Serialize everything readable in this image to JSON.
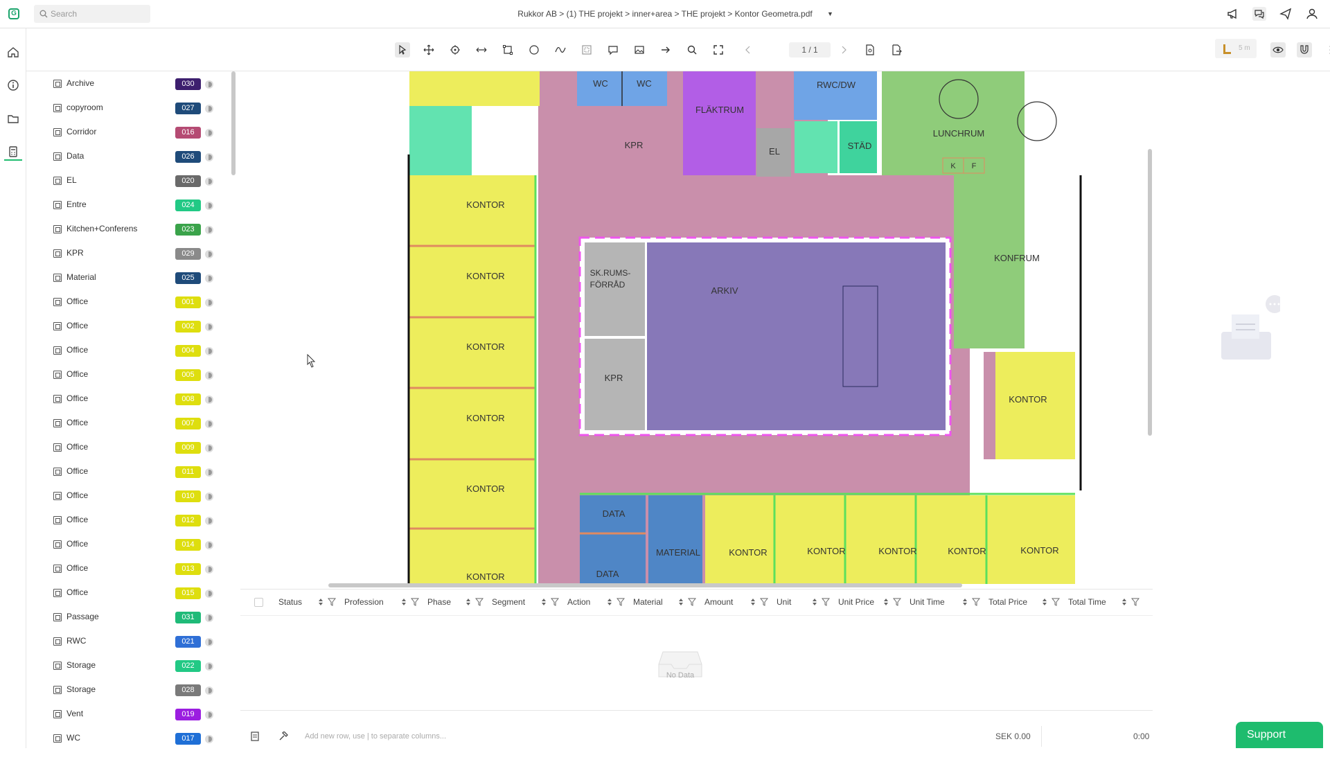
{
  "topbar": {
    "search_placeholder": "Search",
    "breadcrumb": "Rukkor AB > (1) THE projekt > inner+area > THE projekt > Kontor Geometra.pdf"
  },
  "toolbar": {
    "page_indicator": "1 / 1",
    "scale_label": "5 m"
  },
  "layers": [
    {
      "name": "Archive",
      "code": "030",
      "color": "#3d1f6e"
    },
    {
      "name": "copyroom",
      "code": "027",
      "color": "#1f4b7a"
    },
    {
      "name": "Corridor",
      "code": "016",
      "color": "#b54b73"
    },
    {
      "name": "Data",
      "code": "026",
      "color": "#1f4b7a"
    },
    {
      "name": "EL",
      "code": "020",
      "color": "#6a6a6a"
    },
    {
      "name": "Entre",
      "code": "024",
      "color": "#22c985"
    },
    {
      "name": "Kitchen+Conferens",
      "code": "023",
      "color": "#3aa34a"
    },
    {
      "name": "KPR",
      "code": "029",
      "color": "#8a8a8a"
    },
    {
      "name": "Material",
      "code": "025",
      "color": "#1f4b7a"
    },
    {
      "name": "Office",
      "code": "001",
      "color": "#dede0e"
    },
    {
      "name": "Office",
      "code": "002",
      "color": "#dede0e"
    },
    {
      "name": "Office",
      "code": "004",
      "color": "#dede0e"
    },
    {
      "name": "Office",
      "code": "005",
      "color": "#dede0e"
    },
    {
      "name": "Office",
      "code": "008",
      "color": "#dede0e"
    },
    {
      "name": "Office",
      "code": "007",
      "color": "#dede0e"
    },
    {
      "name": "Office",
      "code": "009",
      "color": "#dede0e"
    },
    {
      "name": "Office",
      "code": "011",
      "color": "#dede0e"
    },
    {
      "name": "Office",
      "code": "010",
      "color": "#dede0e"
    },
    {
      "name": "Office",
      "code": "012",
      "color": "#dede0e"
    },
    {
      "name": "Office",
      "code": "014",
      "color": "#dede0e"
    },
    {
      "name": "Office",
      "code": "013",
      "color": "#dede0e"
    },
    {
      "name": "Office",
      "code": "015",
      "color": "#dede0e"
    },
    {
      "name": "Passage",
      "code": "031",
      "color": "#1fba78"
    },
    {
      "name": "RWC",
      "code": "021",
      "color": "#2f6fd6"
    },
    {
      "name": "Storage",
      "code": "022",
      "color": "#22c985"
    },
    {
      "name": "Storage",
      "code": "028",
      "color": "#7a7a7a"
    },
    {
      "name": "Vent",
      "code": "019",
      "color": "#9b1ee0"
    },
    {
      "name": "WC",
      "code": "017",
      "color": "#1f6fd6"
    }
  ],
  "plan_labels": {
    "wc1": "WC",
    "wc2": "WC",
    "rwc": "RWC/DW",
    "flaktrum": "FLÄKTRUM",
    "kpr_top": "KPR",
    "el": "EL",
    "stad": "STÄD",
    "lunchrum": "LUNCHRUM",
    "k": "K",
    "f": "F",
    "kontor1": "KONTOR",
    "kontor2": "KONTOR",
    "kontor3": "KONTOR",
    "kontor4": "KONTOR",
    "kontor5": "KONTOR",
    "kontor6": "KONTOR",
    "skrums1": "SK.RUMS-",
    "skrums2": "FÖRRÅD",
    "arkiv": "ARKIV",
    "kpr_mid": "KPR",
    "konfrum": "KONFRUM",
    "kontor_right": "KONTOR",
    "data": "DATA",
    "data_kop": "DATA",
    "material": "MATERIAL",
    "kontor_b1": "KONTOR",
    "kontor_b2": "KONTOR",
    "kontor_b3": "KONTOR",
    "kontor_b4": "KONTOR",
    "kontor_b5": "KONTOR"
  },
  "grid": {
    "columns": [
      "Status",
      "Profession",
      "Phase",
      "Segment",
      "Action",
      "Material",
      "Amount",
      "Unit",
      "Unit Price",
      "Unit Time",
      "Total Price",
      "Total Time"
    ],
    "empty_text": "No Data"
  },
  "footer": {
    "add_row_placeholder": "Add new row, use | to separate columns...",
    "total_price": "SEK 0.00",
    "total_time": "0:00"
  },
  "support_label": "Support"
}
